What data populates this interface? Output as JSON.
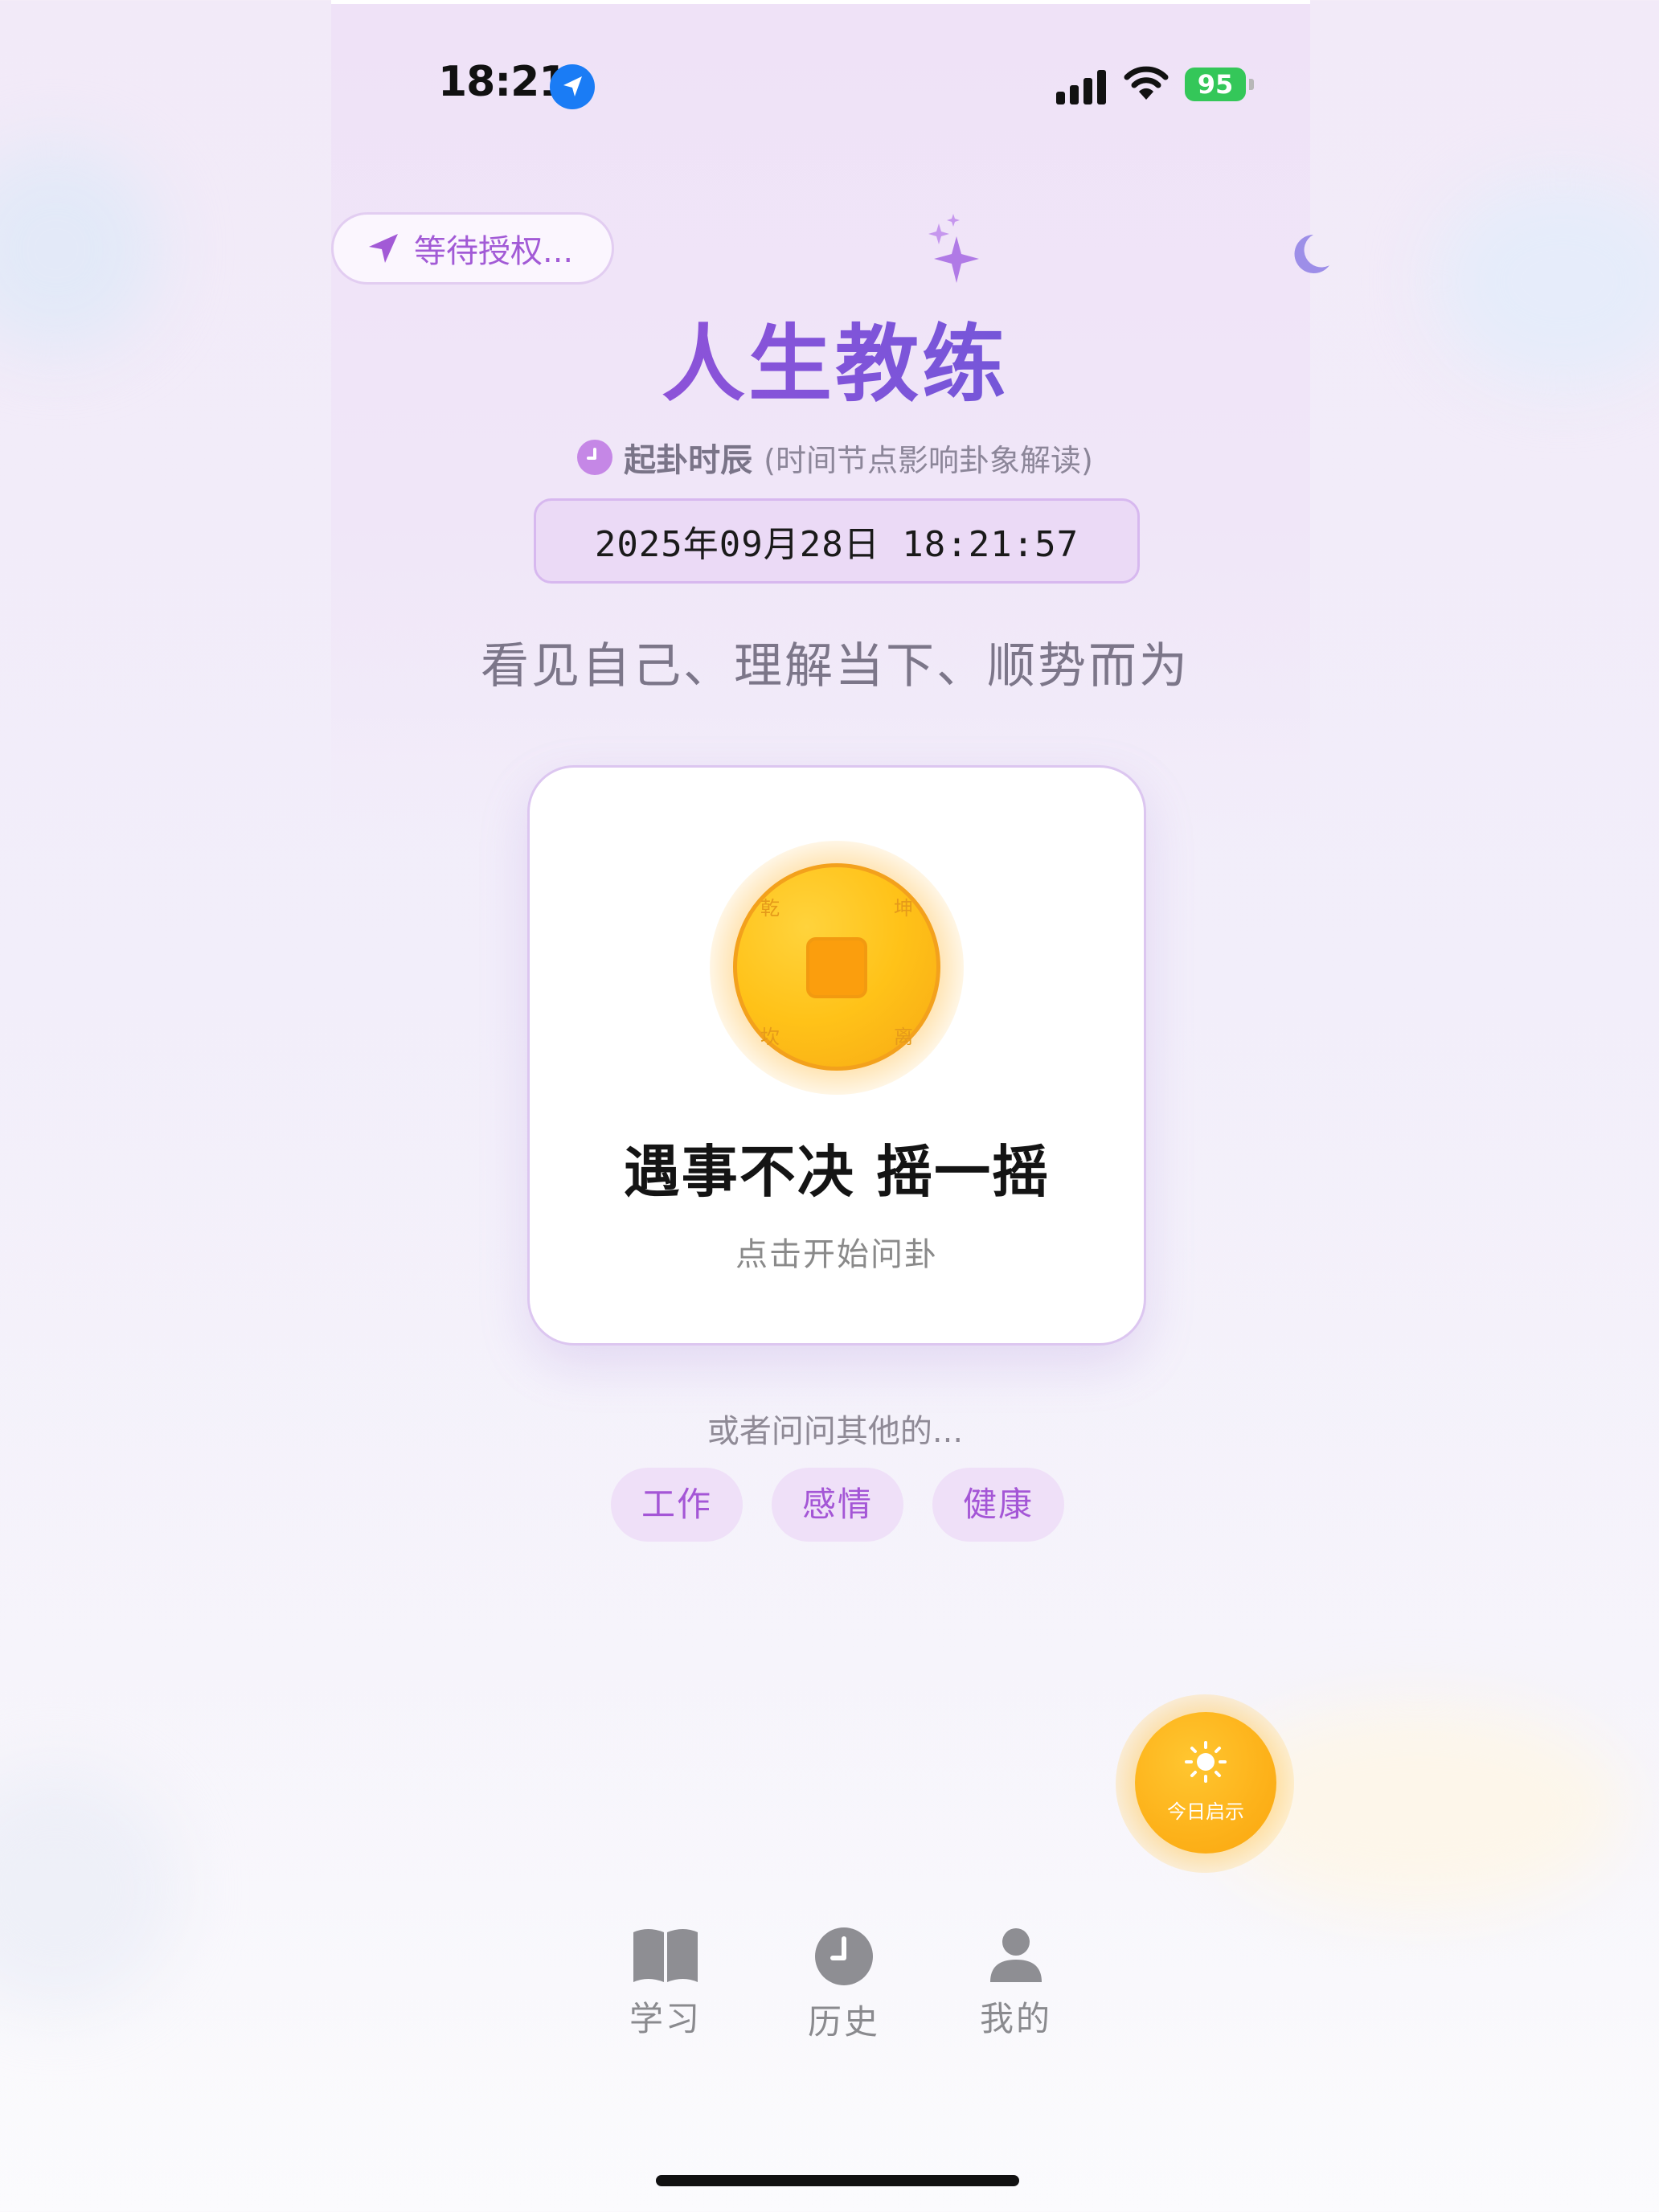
{
  "status_bar": {
    "time": "18:21",
    "battery": "95"
  },
  "location": {
    "label": "等待授权..."
  },
  "app": {
    "title": "人生教练"
  },
  "divination_time": {
    "label": "起卦时辰",
    "note": "(时间节点影响卦象解读)",
    "value": "2025年09月28日 18:21:57"
  },
  "slogan": "看见自己、理解当下、顺势而为",
  "card": {
    "title": "遇事不决 摇一摇",
    "subtitle": "点击开始问卦",
    "coin_chars": [
      "乾",
      "坤",
      "坎",
      "离"
    ]
  },
  "more": {
    "label": "或者问问其他的...",
    "chips": [
      "工作",
      "感情",
      "健康"
    ]
  },
  "daily": {
    "label": "今日启示"
  },
  "nav": {
    "items": [
      "学习",
      "历史",
      "我的"
    ]
  },
  "colors": {
    "accent": "#a456d6",
    "title_gradient_start": "#a34fd8",
    "title_gradient_end": "#5f5ad6",
    "coin": "#ffc218",
    "fab": "#fdb21a",
    "battery": "#34c759",
    "location_arrow": "#1a7cf5"
  }
}
